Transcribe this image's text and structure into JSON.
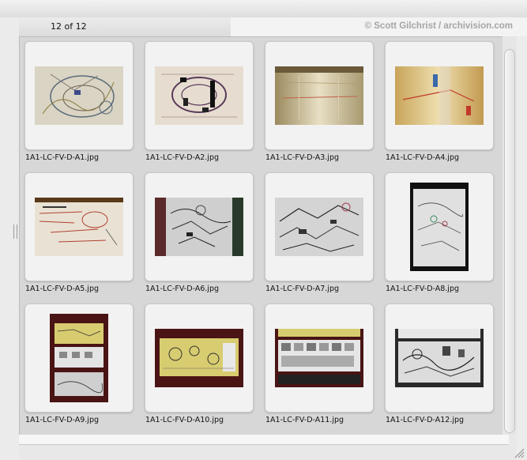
{
  "header": {
    "count_text": "12 of 12",
    "copyright": "© Scott Gilchrist / archivision.com"
  },
  "gallery": {
    "items": [
      {
        "filename": "1A1-LC-FV-D-A1.jpg"
      },
      {
        "filename": "1A1-LC-FV-D-A2.jpg"
      },
      {
        "filename": "1A1-LC-FV-D-A3.jpg"
      },
      {
        "filename": "1A1-LC-FV-D-A4.jpg"
      },
      {
        "filename": "1A1-LC-FV-D-A5.jpg"
      },
      {
        "filename": "1A1-LC-FV-D-A6.jpg"
      },
      {
        "filename": "1A1-LC-FV-D-A7.jpg"
      },
      {
        "filename": "1A1-LC-FV-D-A8.jpg"
      },
      {
        "filename": "1A1-LC-FV-D-A9.jpg"
      },
      {
        "filename": "1A1-LC-FV-D-A10.jpg"
      },
      {
        "filename": "1A1-LC-FV-D-A11.jpg"
      },
      {
        "filename": "1A1-LC-FV-D-A12.jpg"
      }
    ]
  },
  "colors": {
    "window_bg": "#e8e8e8",
    "gallery_bg": "#d7d7d7",
    "copyright_text": "#a5a5a5"
  }
}
